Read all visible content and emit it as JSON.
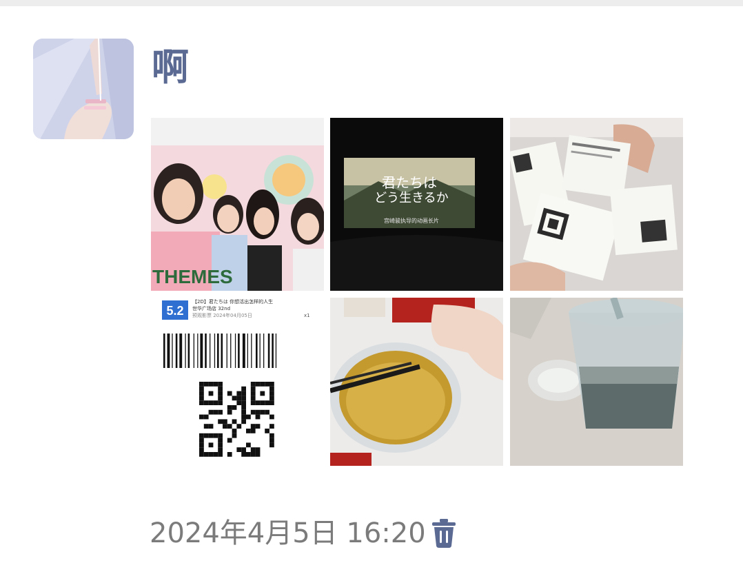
{
  "post": {
    "author_name": "啊",
    "timestamp": "2024年4月5日 16:20",
    "delete_icon": "trash-icon"
  },
  "photos": [
    {
      "name": "photo-selfie",
      "text": "THEMES"
    },
    {
      "name": "photo-cinema-screen",
      "line1": "君たちは",
      "line2": "どう生きるか",
      "caption": "宫崎骏执导的动画长片"
    },
    {
      "name": "photo-tickets"
    },
    {
      "name": "photo-ticket-qr",
      "badge": "5.2",
      "line1": "【2D】君たちは 你想活出怎样的人生",
      "line2": "世华广场店 32nd",
      "line3": "预观影票 2024年04月05日",
      "count": "x1"
    },
    {
      "name": "photo-food-bowl"
    },
    {
      "name": "photo-drink-cup"
    }
  ],
  "colors": {
    "author": "#5b6a93",
    "timestamp": "#7b7b7b",
    "trash": "#5b6a93",
    "badge": "#2f6fd1"
  }
}
